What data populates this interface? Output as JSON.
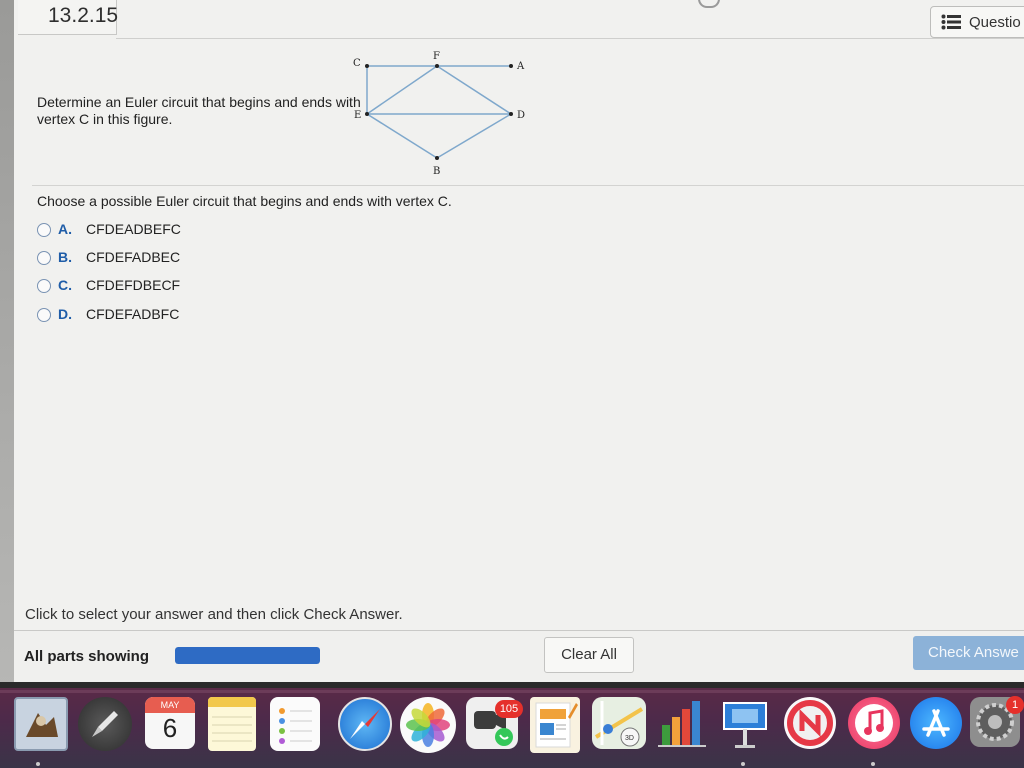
{
  "header": {
    "question_number": "13.2.15",
    "questions_button_label": "Questio"
  },
  "question": {
    "prompt": "Determine an Euler circuit that begins and ends with vertex C in this figure.",
    "instruction": "Choose a possible Euler circuit that begins and ends with vertex C.",
    "figure": {
      "vertex_labels": [
        "C",
        "F",
        "A",
        "E",
        "D",
        "B"
      ],
      "edges": [
        [
          "C",
          "A"
        ],
        [
          "C",
          "E"
        ],
        [
          "F",
          "E"
        ],
        [
          "F",
          "D"
        ],
        [
          "E",
          "D"
        ],
        [
          "E",
          "B"
        ],
        [
          "D",
          "B"
        ]
      ]
    },
    "options": [
      {
        "letter": "A.",
        "text": "CFDEADBEFC"
      },
      {
        "letter": "B.",
        "text": "CFDEFADBEC"
      },
      {
        "letter": "C.",
        "text": "CFDEFDBECF"
      },
      {
        "letter": "D.",
        "text": "CFDEFADBFC"
      }
    ]
  },
  "footer": {
    "instruction": "Click to select your answer and then click Check Answer.",
    "parts_label": "All parts showing",
    "progress_fraction": 1.0,
    "clear_label": "Clear All",
    "check_label": "Check Answe"
  },
  "dock": {
    "calendar_month": "MAY",
    "calendar_day": "6",
    "facetime_badge": "105",
    "preferences_badge": "1",
    "icons": [
      "preview-icon",
      "launchpad-icon",
      "calendar-icon",
      "notes-icon",
      "reminders-icon",
      "safari-icon",
      "photos-icon",
      "facetime-icon",
      "pages-icon",
      "maps-icon",
      "numbers-icon",
      "keynote-icon",
      "news-icon",
      "music-icon",
      "app-store-icon",
      "system-preferences-icon"
    ]
  },
  "colors": {
    "accent_blue": "#2e6bc4",
    "option_letter": "#1f5da8",
    "check_button": "#8cb2d8"
  }
}
